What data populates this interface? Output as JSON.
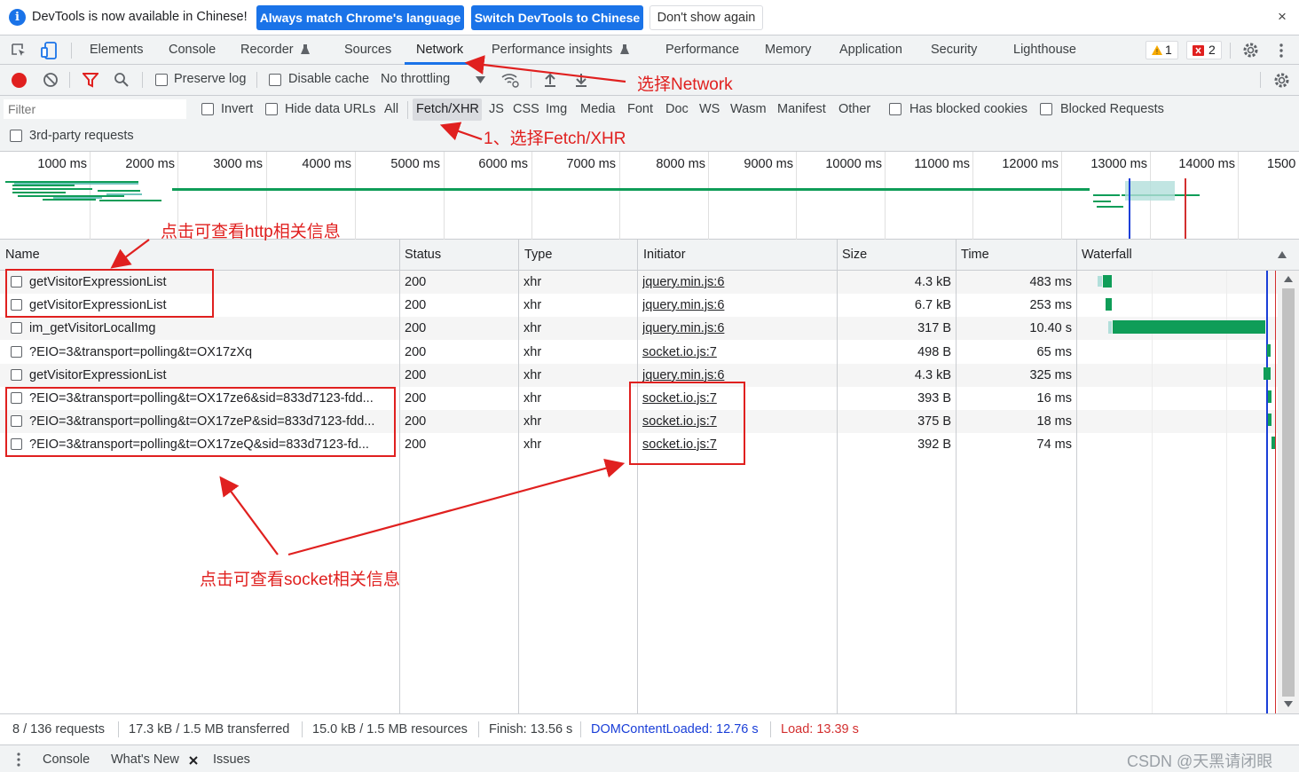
{
  "infobar": {
    "message": "DevTools is now available in Chinese!",
    "match_button": "Always match Chrome's language",
    "switch_button": "Switch DevTools to Chinese",
    "dismiss_button": "Don't show again",
    "close": "×"
  },
  "tabs": [
    "Elements",
    "Console",
    "Recorder",
    "Sources",
    "Network",
    "Performance insights",
    "Performance",
    "Memory",
    "Application",
    "Security",
    "Lighthouse"
  ],
  "active_tab": "Network",
  "badges": {
    "warnings": "1",
    "errors": "2"
  },
  "toolbar": {
    "preserve_log": "Preserve log",
    "disable_cache": "Disable cache",
    "throttling": "No throttling"
  },
  "filter": {
    "placeholder": "Filter",
    "invert": "Invert",
    "hide_data_urls": "Hide data URLs",
    "types": [
      "All",
      "Fetch/XHR",
      "JS",
      "CSS",
      "Img",
      "Media",
      "Font",
      "Doc",
      "WS",
      "Wasm",
      "Manifest",
      "Other"
    ],
    "selected_type": "Fetch/XHR",
    "has_blocked_cookies": "Has blocked cookies",
    "blocked_requests": "Blocked Requests",
    "third_party": "3rd-party requests"
  },
  "overview_ticks": [
    "1000 ms",
    "2000 ms",
    "3000 ms",
    "4000 ms",
    "5000 ms",
    "6000 ms",
    "7000 ms",
    "8000 ms",
    "9000 ms",
    "10000 ms",
    "11000 ms",
    "12000 ms",
    "13000 ms",
    "14000 ms",
    "1500"
  ],
  "columns": [
    "Name",
    "Status",
    "Type",
    "Initiator",
    "Size",
    "Time",
    "Waterfall"
  ],
  "requests": [
    {
      "name": "getVisitorExpressionList",
      "status": "200",
      "type": "xhr",
      "initiator": "jquery.min.js:6",
      "size": "4.3 kB",
      "time": "483 ms"
    },
    {
      "name": "getVisitorExpressionList",
      "status": "200",
      "type": "xhr",
      "initiator": "jquery.min.js:6",
      "size": "6.7 kB",
      "time": "253 ms"
    },
    {
      "name": "im_getVisitorLocalImg",
      "status": "200",
      "type": "xhr",
      "initiator": "jquery.min.js:6",
      "size": "317 B",
      "time": "10.40 s"
    },
    {
      "name": "?EIO=3&transport=polling&t=OX17zXq",
      "status": "200",
      "type": "xhr",
      "initiator": "socket.io.js:7",
      "size": "498 B",
      "time": "65 ms"
    },
    {
      "name": "getVisitorExpressionList",
      "status": "200",
      "type": "xhr",
      "initiator": "jquery.min.js:6",
      "size": "4.3 kB",
      "time": "325 ms"
    },
    {
      "name": "?EIO=3&transport=polling&t=OX17ze6&sid=833d7123-fdd...",
      "status": "200",
      "type": "xhr",
      "initiator": "socket.io.js:7",
      "size": "393 B",
      "time": "16 ms"
    },
    {
      "name": "?EIO=3&transport=polling&t=OX17zeP&sid=833d7123-fdd...",
      "status": "200",
      "type": "xhr",
      "initiator": "socket.io.js:7",
      "size": "375 B",
      "time": "18 ms"
    },
    {
      "name": "?EIO=3&transport=polling&t=OX17zeQ&sid=833d7123-fd...",
      "status": "200",
      "type": "xhr",
      "initiator": "socket.io.js:7",
      "size": "392 B",
      "time": "74 ms"
    }
  ],
  "status": {
    "requests": "8 / 136 requests",
    "transferred": "17.3 kB / 1.5 MB transferred",
    "resources": "15.0 kB / 1.5 MB resources",
    "finish": "Finish: 13.56 s",
    "dcl": "DOMContentLoaded: 12.76 s",
    "load": "Load: 13.39 s"
  },
  "drawer": {
    "console": "Console",
    "whats_new": "What's New",
    "issues": "Issues"
  },
  "annotations": {
    "select_network": "选择Network",
    "select_fetch": "1、选择Fetch/XHR",
    "http_info": "点击可查看http相关信息",
    "socket_info": "点击可查看socket相关信息",
    "watermark": "CSDN @天黑请闭眼"
  },
  "colors": {
    "accent": "#1a73e8",
    "annotation_red": "#e0201f",
    "waterfall_green": "#0f9d58",
    "dcl_blue": "#1a3fd8",
    "load_red": "#d32f2f"
  }
}
